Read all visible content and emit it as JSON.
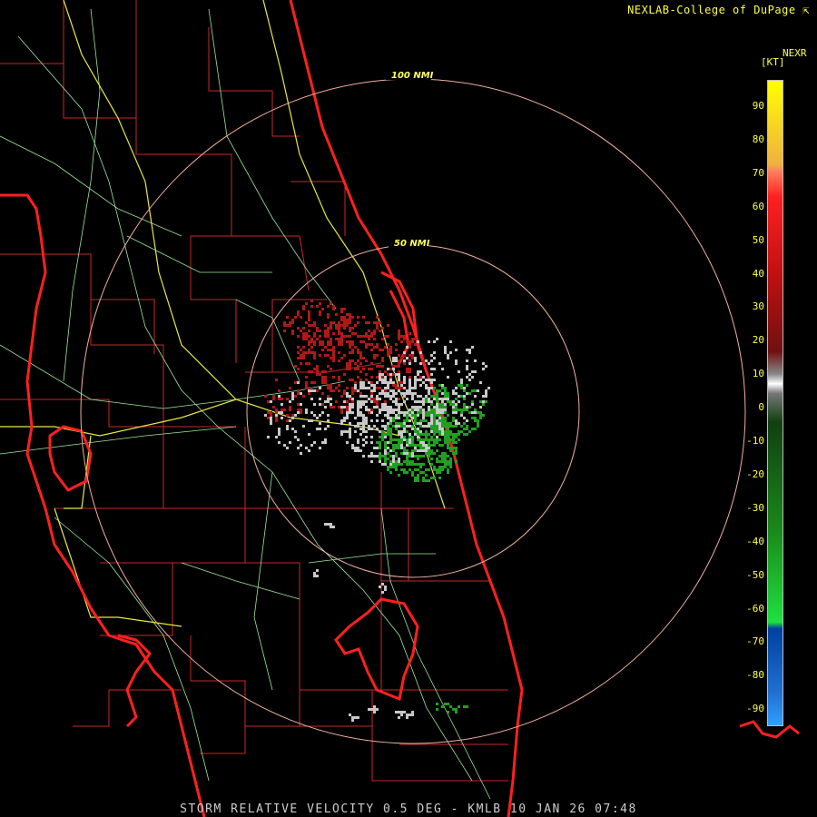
{
  "header": {
    "credit": "NEXLAB-College of DuPage"
  },
  "footer": {
    "product": "STORM RELATIVE VELOCITY 0.5 DEG - KMLB 10 JAN 26 07:48"
  },
  "rings": [
    {
      "label": "100 NMI"
    },
    {
      "label": "50 NMI"
    }
  ],
  "legend": {
    "title": "NEXR",
    "unit": "[KT]",
    "ticks": [
      "90",
      "80",
      "70",
      "60",
      "50",
      "40",
      "30",
      "20",
      "10",
      "0",
      "-10",
      "-20",
      "-30",
      "-40",
      "-50",
      "-60",
      "-70",
      "-80",
      "-90"
    ]
  },
  "colors": {
    "county_lines": "#c82828",
    "coastline": "#ff2020",
    "roads": "#9ee89e",
    "interstates": "#e8e840",
    "range_rings": "#f0b0a0",
    "inbound": "#20a020",
    "outbound": "#b01818",
    "near_zero": "#c8c8c8"
  }
}
